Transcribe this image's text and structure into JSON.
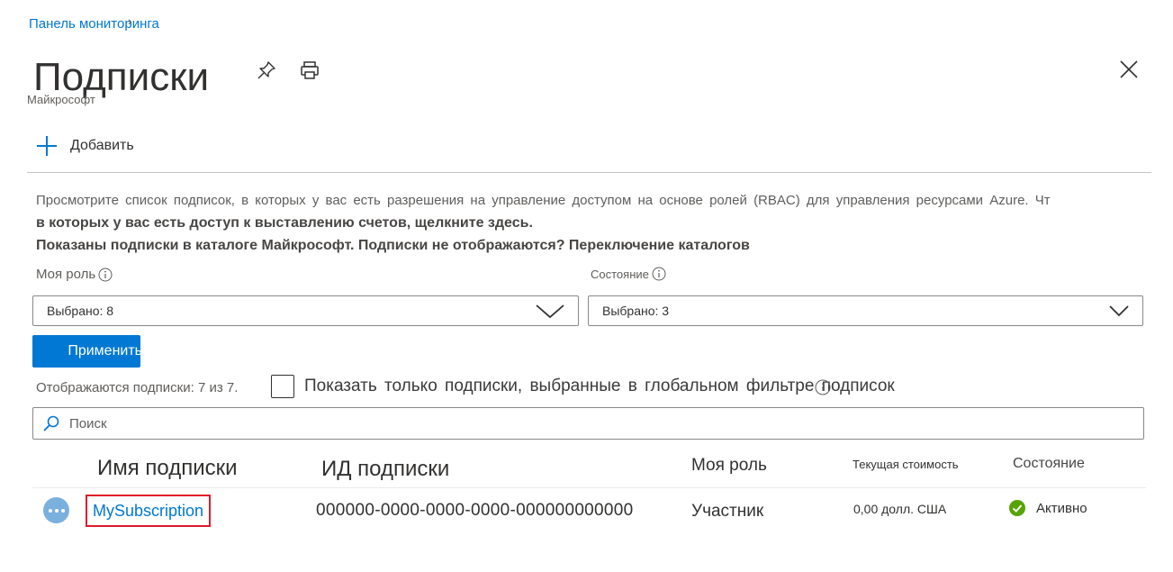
{
  "breadcrumb": {
    "item": "Панель мониторинга"
  },
  "header": {
    "title": "Подписки",
    "subtitle": "Майкрософт",
    "pin_icon": "pin-icon",
    "print_icon": "printer-icon",
    "close_icon": "close-icon"
  },
  "toolbar": {
    "add_label": "Добавить"
  },
  "description": {
    "line1": "Просмотрите список подписок, в которых у вас есть разрешения на управление доступом на основе ролей (RBAC) для управления ресурсами Azure. Чт",
    "line2": "в которых у вас есть доступ к выставлению счетов, щелкните здесь.",
    "line3": "Показаны подписки в каталоге Майкрософт. Подписки не отображаются? Переключение каталогов"
  },
  "filters": {
    "role_label": "Моя роль",
    "role_value": "Выбрано: 8",
    "state_label": "Состояние",
    "state_value": "Выбрано: 3",
    "apply_label": "Применить"
  },
  "listing": {
    "count_text": "Отображаются подписки: 7 из 7.",
    "global_filter_label": "Показать только подписки, выбранные в глобальном фильтре подписок",
    "search_placeholder": "Поиск"
  },
  "table": {
    "columns": {
      "name": "Имя подписки",
      "id": "ИД подписки",
      "role": "Моя роль",
      "cost": "Текущая стоимость",
      "state": "Состояние"
    },
    "rows": [
      {
        "name": "MySubscription",
        "id": "000000-0000-0000-0000-000000000000",
        "role": "Участник",
        "cost": "0,00 долл. США",
        "state": "Активно"
      }
    ]
  },
  "colors": {
    "accent": "#0078d4",
    "highlight_border": "#e01b2b",
    "status_active": "#57a300"
  }
}
